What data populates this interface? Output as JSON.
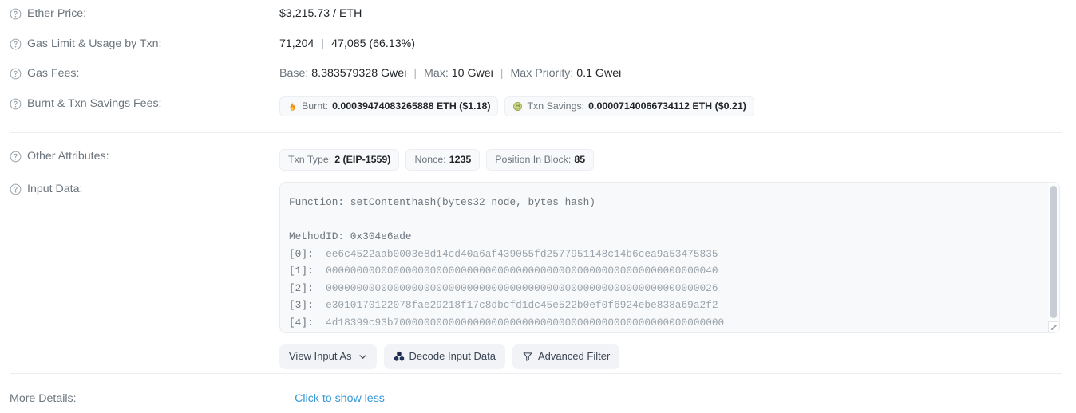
{
  "rows": {
    "ether_price": {
      "label": "Ether Price:",
      "value": "$3,215.73 / ETH"
    },
    "gas_limit": {
      "label": "Gas Limit & Usage by Txn:",
      "limit": "71,204",
      "separator": "|",
      "usage": "47,085 (66.13%)"
    },
    "gas_fees": {
      "label": "Gas Fees:",
      "base_key": "Base:",
      "base_value": "8.383579328 Gwei",
      "separator": "|",
      "max_key": "Max:",
      "max_value": "10 Gwei",
      "priority_key": "Max Priority:",
      "priority_value": "0.1 Gwei"
    },
    "burnt_savings": {
      "label": "Burnt & Txn Savings Fees:",
      "burnt": {
        "icon": "flame-icon",
        "key": "Burnt:",
        "value": "0.00039474083265888 ETH ($1.18)"
      },
      "savings": {
        "icon": "coin-icon",
        "key": "Txn Savings:",
        "value": "0.00007140066734112 ETH ($0.21)"
      }
    },
    "other_attributes": {
      "label": "Other Attributes:",
      "pills": [
        {
          "key": "Txn Type:",
          "value": "2 (EIP-1559)"
        },
        {
          "key": "Nonce:",
          "value": "1235"
        },
        {
          "key": "Position In Block:",
          "value": "85"
        }
      ]
    },
    "input_data": {
      "label": "Input Data:",
      "function_line": "Function: setContenthash(bytes32 node, bytes hash)",
      "blank_line": "",
      "method_id_line": "MethodID: 0x304e6ade",
      "args": [
        {
          "index": "[0]:",
          "hex": "ee6c4522aab0003e8d14cd40a6af439055fd2577951148c14b6cea9a53475835"
        },
        {
          "index": "[1]:",
          "hex": "0000000000000000000000000000000000000000000000000000000000000040"
        },
        {
          "index": "[2]:",
          "hex": "0000000000000000000000000000000000000000000000000000000000000026"
        },
        {
          "index": "[3]:",
          "hex": "e3010170122078fae29218f17c8dbcfd1dc45e522b0ef0f6924ebe838a69a2f2"
        },
        {
          "index": "[4]:",
          "hex": "4d18399c93b700000000000000000000000000000000000000000000000000000"
        }
      ],
      "buttons": [
        {
          "label": "View Input As",
          "icon": "chevron-down-icon"
        },
        {
          "label": "Decode Input Data",
          "icon": "cubes-icon"
        },
        {
          "label": "Advanced Filter",
          "icon": "funnel-sparkle-icon"
        }
      ]
    },
    "more_details": {
      "label": "More Details:",
      "link_dash": "—",
      "link_text": "Click to show less"
    }
  },
  "colors": {
    "label": "#6c757d",
    "value": "#212529",
    "link": "#3498db",
    "pill_bg": "#f8f9fa",
    "pill_border": "#eceef1",
    "button_bg": "#f1f3f6",
    "divider": "#eceef1",
    "code_text": "#9aa3ab"
  }
}
